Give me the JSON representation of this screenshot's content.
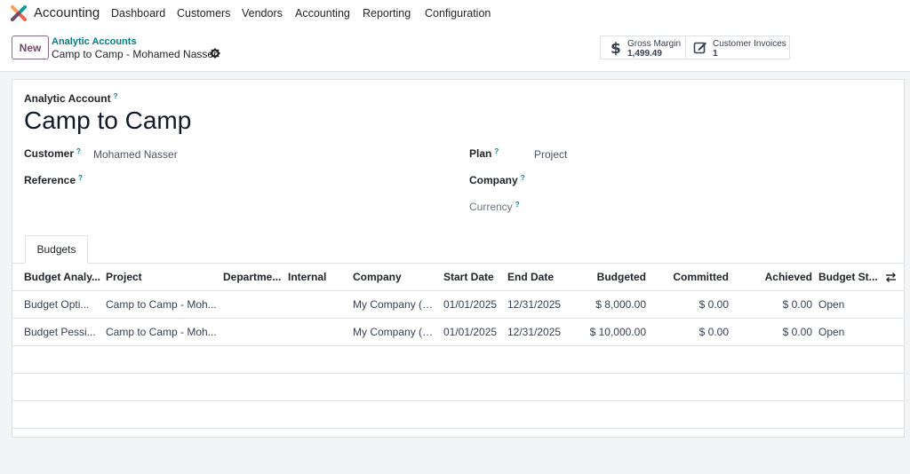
{
  "app": {
    "name": "Accounting",
    "menu": [
      "Dashboard",
      "Customers",
      "Vendors",
      "Accounting",
      "Reporting",
      "Configuration"
    ]
  },
  "control": {
    "new_label": "New",
    "breadcrumb_parent": "Analytic Accounts",
    "breadcrumb_current": "Camp to Camp - Mohamed Nasser",
    "smart_buttons": [
      {
        "label": "Gross Margin",
        "value": "1,499.49",
        "icon": "dollar-icon"
      },
      {
        "label": "Customer Invoices",
        "value": "1",
        "icon": "edit-invoice-icon"
      }
    ]
  },
  "form": {
    "record_label": "Analytic Account",
    "title": "Camp to Camp",
    "customer_label": "Customer",
    "customer_value": "Mohamed Nasser",
    "reference_label": "Reference",
    "plan_label": "Plan",
    "plan_value": "Project",
    "company_label": "Company",
    "currency_label": "Currency",
    "help_mark": "?"
  },
  "tabs": [
    "Budgets"
  ],
  "table": {
    "headers": [
      "Budget Analy...",
      "Project",
      "Departme...",
      "Internal",
      "Company",
      "Start Date",
      "End Date",
      "Budgeted",
      "Committed",
      "Achieved",
      "Budget St..."
    ],
    "rows": [
      [
        "Budget Opti...",
        "Camp to Camp - Moh...",
        "",
        "",
        "My Company (S...",
        "01/01/2025",
        "12/31/2025",
        "$ 8,000.00",
        "$ 0.00",
        "$ 0.00",
        "Open"
      ],
      [
        "Budget Pessi...",
        "Camp to Camp - Moh...",
        "",
        "",
        "My Company (S...",
        "01/01/2025",
        "12/31/2025",
        "$ 10,000.00",
        "$ 0.00",
        "$ 0.00",
        "Open"
      ]
    ]
  },
  "colors": {
    "brand": "#714B67",
    "link": "#017e84",
    "border": "#dee2e6",
    "background": "#f3f4f6"
  }
}
